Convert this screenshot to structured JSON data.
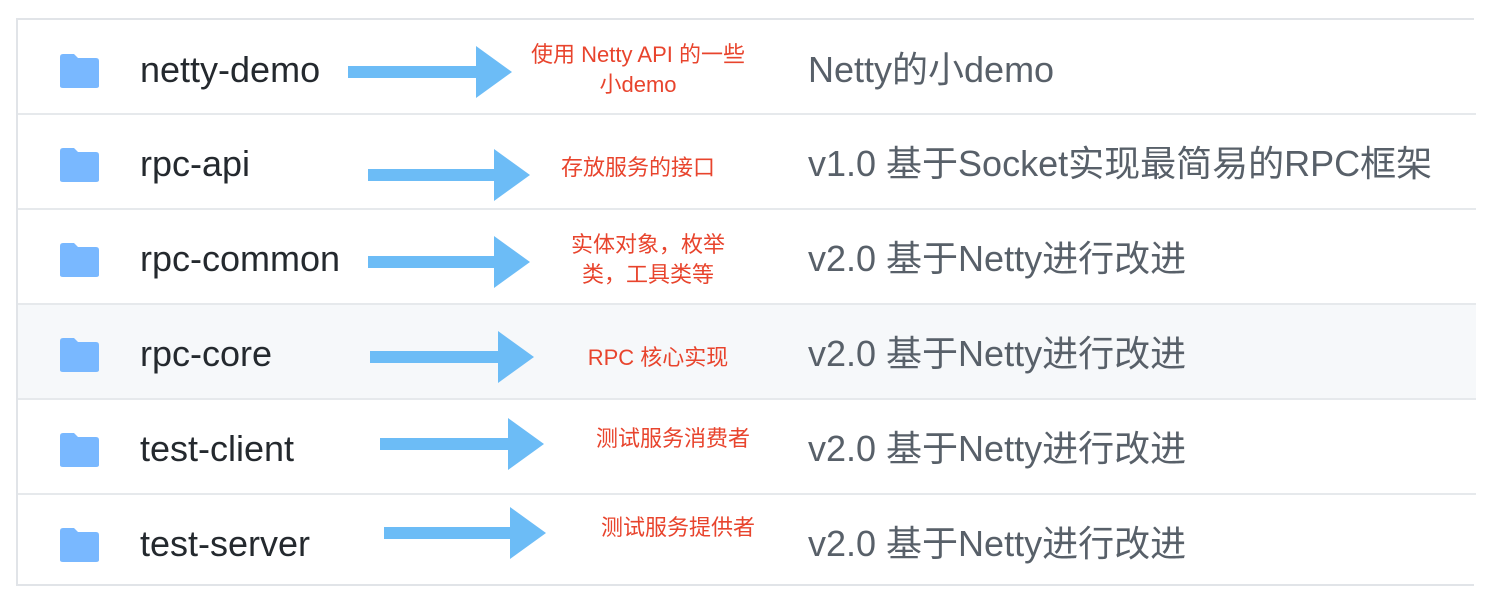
{
  "colors": {
    "folder": "#79b8ff",
    "arrow": "#6cbcf6",
    "note": "#e8442d",
    "name": "#24292e",
    "message": "#586069",
    "border": "#e1e4e8",
    "row_highlight": "#f6f8fa"
  },
  "rows": [
    {
      "icon": "folder-icon",
      "name": "netty-demo",
      "note_line1": "使用 Netty API 的一些",
      "note_line2": "小demo",
      "message": "Netty的小demo"
    },
    {
      "icon": "folder-icon",
      "name": "rpc-api",
      "note_line1": "存放服务的接口",
      "note_line2": "",
      "message": "v1.0 基于Socket实现最简易的RPC框架"
    },
    {
      "icon": "folder-icon",
      "name": "rpc-common",
      "note_line1": "实体对象，枚举",
      "note_line2": "类，工具类等",
      "message": "v2.0 基于Netty进行改进"
    },
    {
      "icon": "folder-icon",
      "name": "rpc-core",
      "note_line1": "RPC 核心实现",
      "note_line2": "",
      "message": "v2.0 基于Netty进行改进"
    },
    {
      "icon": "folder-icon",
      "name": "test-client",
      "note_line1": "测试服务消费者",
      "note_line2": "",
      "message": "v2.0 基于Netty进行改进"
    },
    {
      "icon": "folder-icon",
      "name": "test-server",
      "note_line1": "测试服务提供者",
      "note_line2": "",
      "message": "v2.0 基于Netty进行改进"
    }
  ]
}
